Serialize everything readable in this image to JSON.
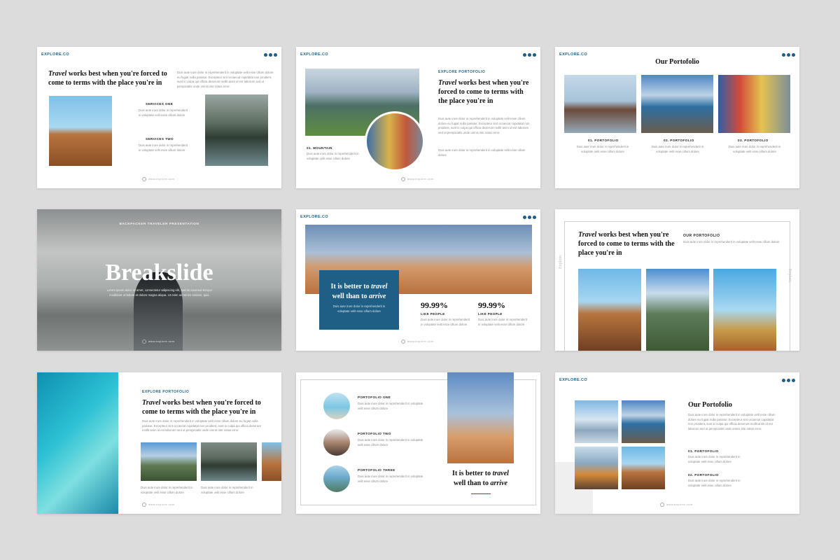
{
  "brand": "EXPLORE.CO",
  "footer_url": "www.explore.com",
  "heading": {
    "italic": "Travel",
    "rest": " works best when you're forced to come to terms with the place you're in"
  },
  "lorem_short": "Duis aute irure dolor in reprehenderit in voluptate velit esse cillum dolore",
  "lorem_long": "Duis aute irure dolor in reprehenderit in voluptate velit esse cillum dolore eu fugiat nulla pariatur. Excepteur sint occaecat cupidatat non proident, sunt in culpa qui officia deserunt mollit anim id est laborum sed ut perspiciatis unde omnis iste natus error.",
  "slide1": {
    "services_one": "SERVICES ONE",
    "services_two": "SERVICES TWO"
  },
  "slide2": {
    "kicker": "EXPLORE PORTOFOLIO",
    "mountain": "01. MOUNTAIN"
  },
  "slide3": {
    "title": "Our Portofolio",
    "items": [
      "01. PORTOFOLIO",
      "02. PORTOFOLIO",
      "03. PORTOFOLIO"
    ]
  },
  "slide4": {
    "kicker": "BACKPACKER TRAVELER PRESENTATION",
    "title": "Breakslide",
    "text": "Lorem ipsum dolor sit amet, consectetur adipiscing elit, sed do eiusmod tempor incididunt ut labore et dolore magna aliqua. Ut enim ad minim veniam, quis."
  },
  "slide5": {
    "quote_a": "It is better to ",
    "quote_b": "travel",
    "quote_c": " well than to ",
    "quote_d": "arrive",
    "stat1": {
      "value": "99.99%",
      "label": "LIKE PEOPLE"
    },
    "stat2": {
      "value": "99.99%",
      "label": "LIKE PEOPLE"
    }
  },
  "slide6": {
    "kicker": "OUR PORTOFOLIO",
    "side_left": "Explore.",
    "side_right": "Explore."
  },
  "slide7": {
    "kicker": "EXPLORE PORTOFOLIO"
  },
  "slide8": {
    "items": [
      "PORTOFOLIO ONE",
      "PORTOFOLIO TWO",
      "PORTOFOLIO THREE"
    ]
  },
  "slide9": {
    "title": "Our Portofolio",
    "items": [
      "01. PORTOFOLIO",
      "02. PORTOFOLIO"
    ]
  },
  "colors": {
    "accent": "#1f5f86",
    "background": "#dcdcdc"
  }
}
